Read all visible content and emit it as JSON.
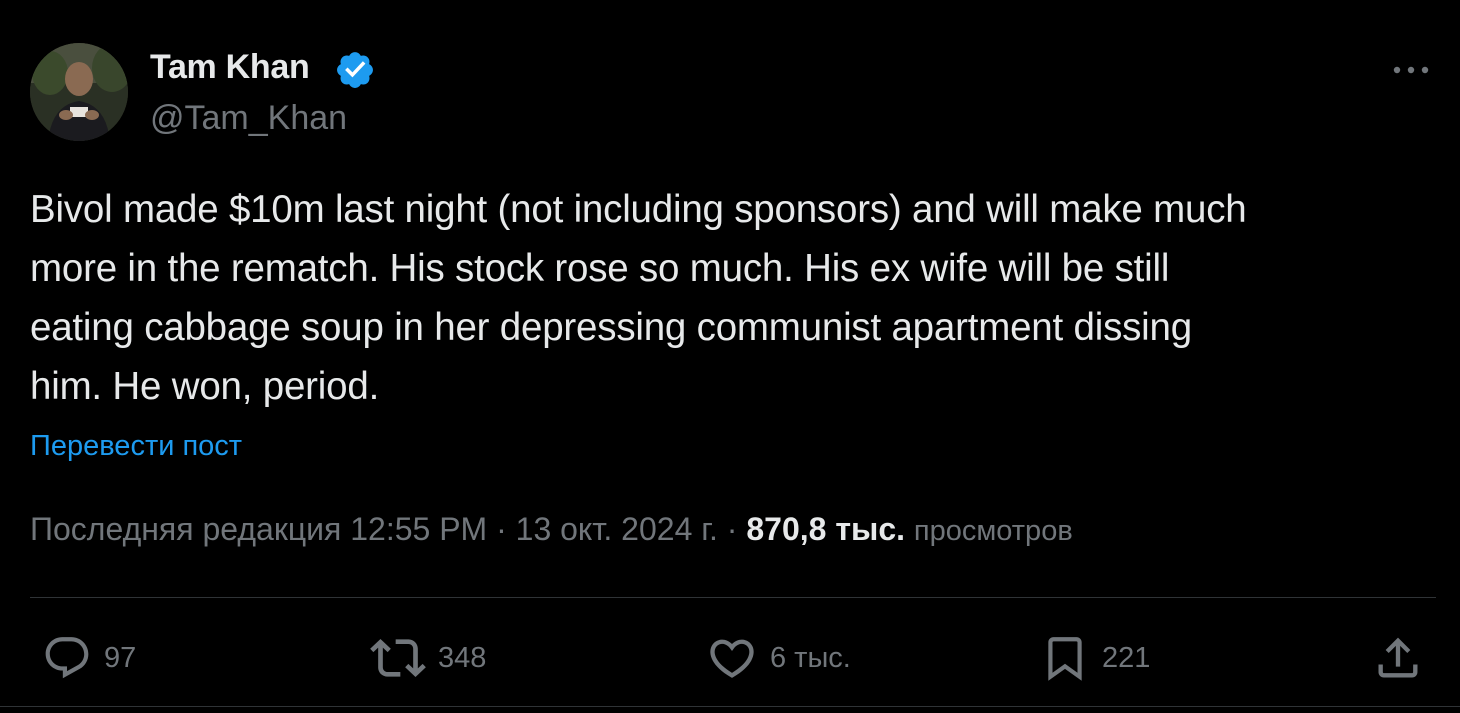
{
  "author": {
    "name": "Tam Khan",
    "handle": "@Tam_Khan",
    "verified": true
  },
  "tweet": {
    "text": "Bivol made $10m last night (not including sponsors) and will make much\nmore in the rematch. His stock rose so much. His ex wife will be still\neating cabbage soup in her depressing communist apartment dissing\nhim. He won, period.",
    "translate_label": "Перевести пост"
  },
  "meta": {
    "edited_label": "Последняя редакция",
    "time": "12:55 PM",
    "separator": "·",
    "date": "13 окт. 2024 г.",
    "views_count": "870,8 тыс.",
    "views_label": "просмотров"
  },
  "actions": {
    "replies": "97",
    "reposts": "348",
    "likes": "6 тыс.",
    "bookmarks": "221"
  },
  "colors": {
    "background": "#000000",
    "text_primary": "#e7e9ea",
    "text_secondary": "#71767b",
    "accent": "#1d9bf0",
    "border": "#2f3336"
  },
  "icons": {
    "more": "more-horizontal-icon",
    "verified": "verified-badge-icon",
    "reply": "reply-bubble-icon",
    "repost": "repost-icon",
    "like": "heart-icon",
    "bookmark": "bookmark-icon",
    "share": "share-upload-icon"
  }
}
